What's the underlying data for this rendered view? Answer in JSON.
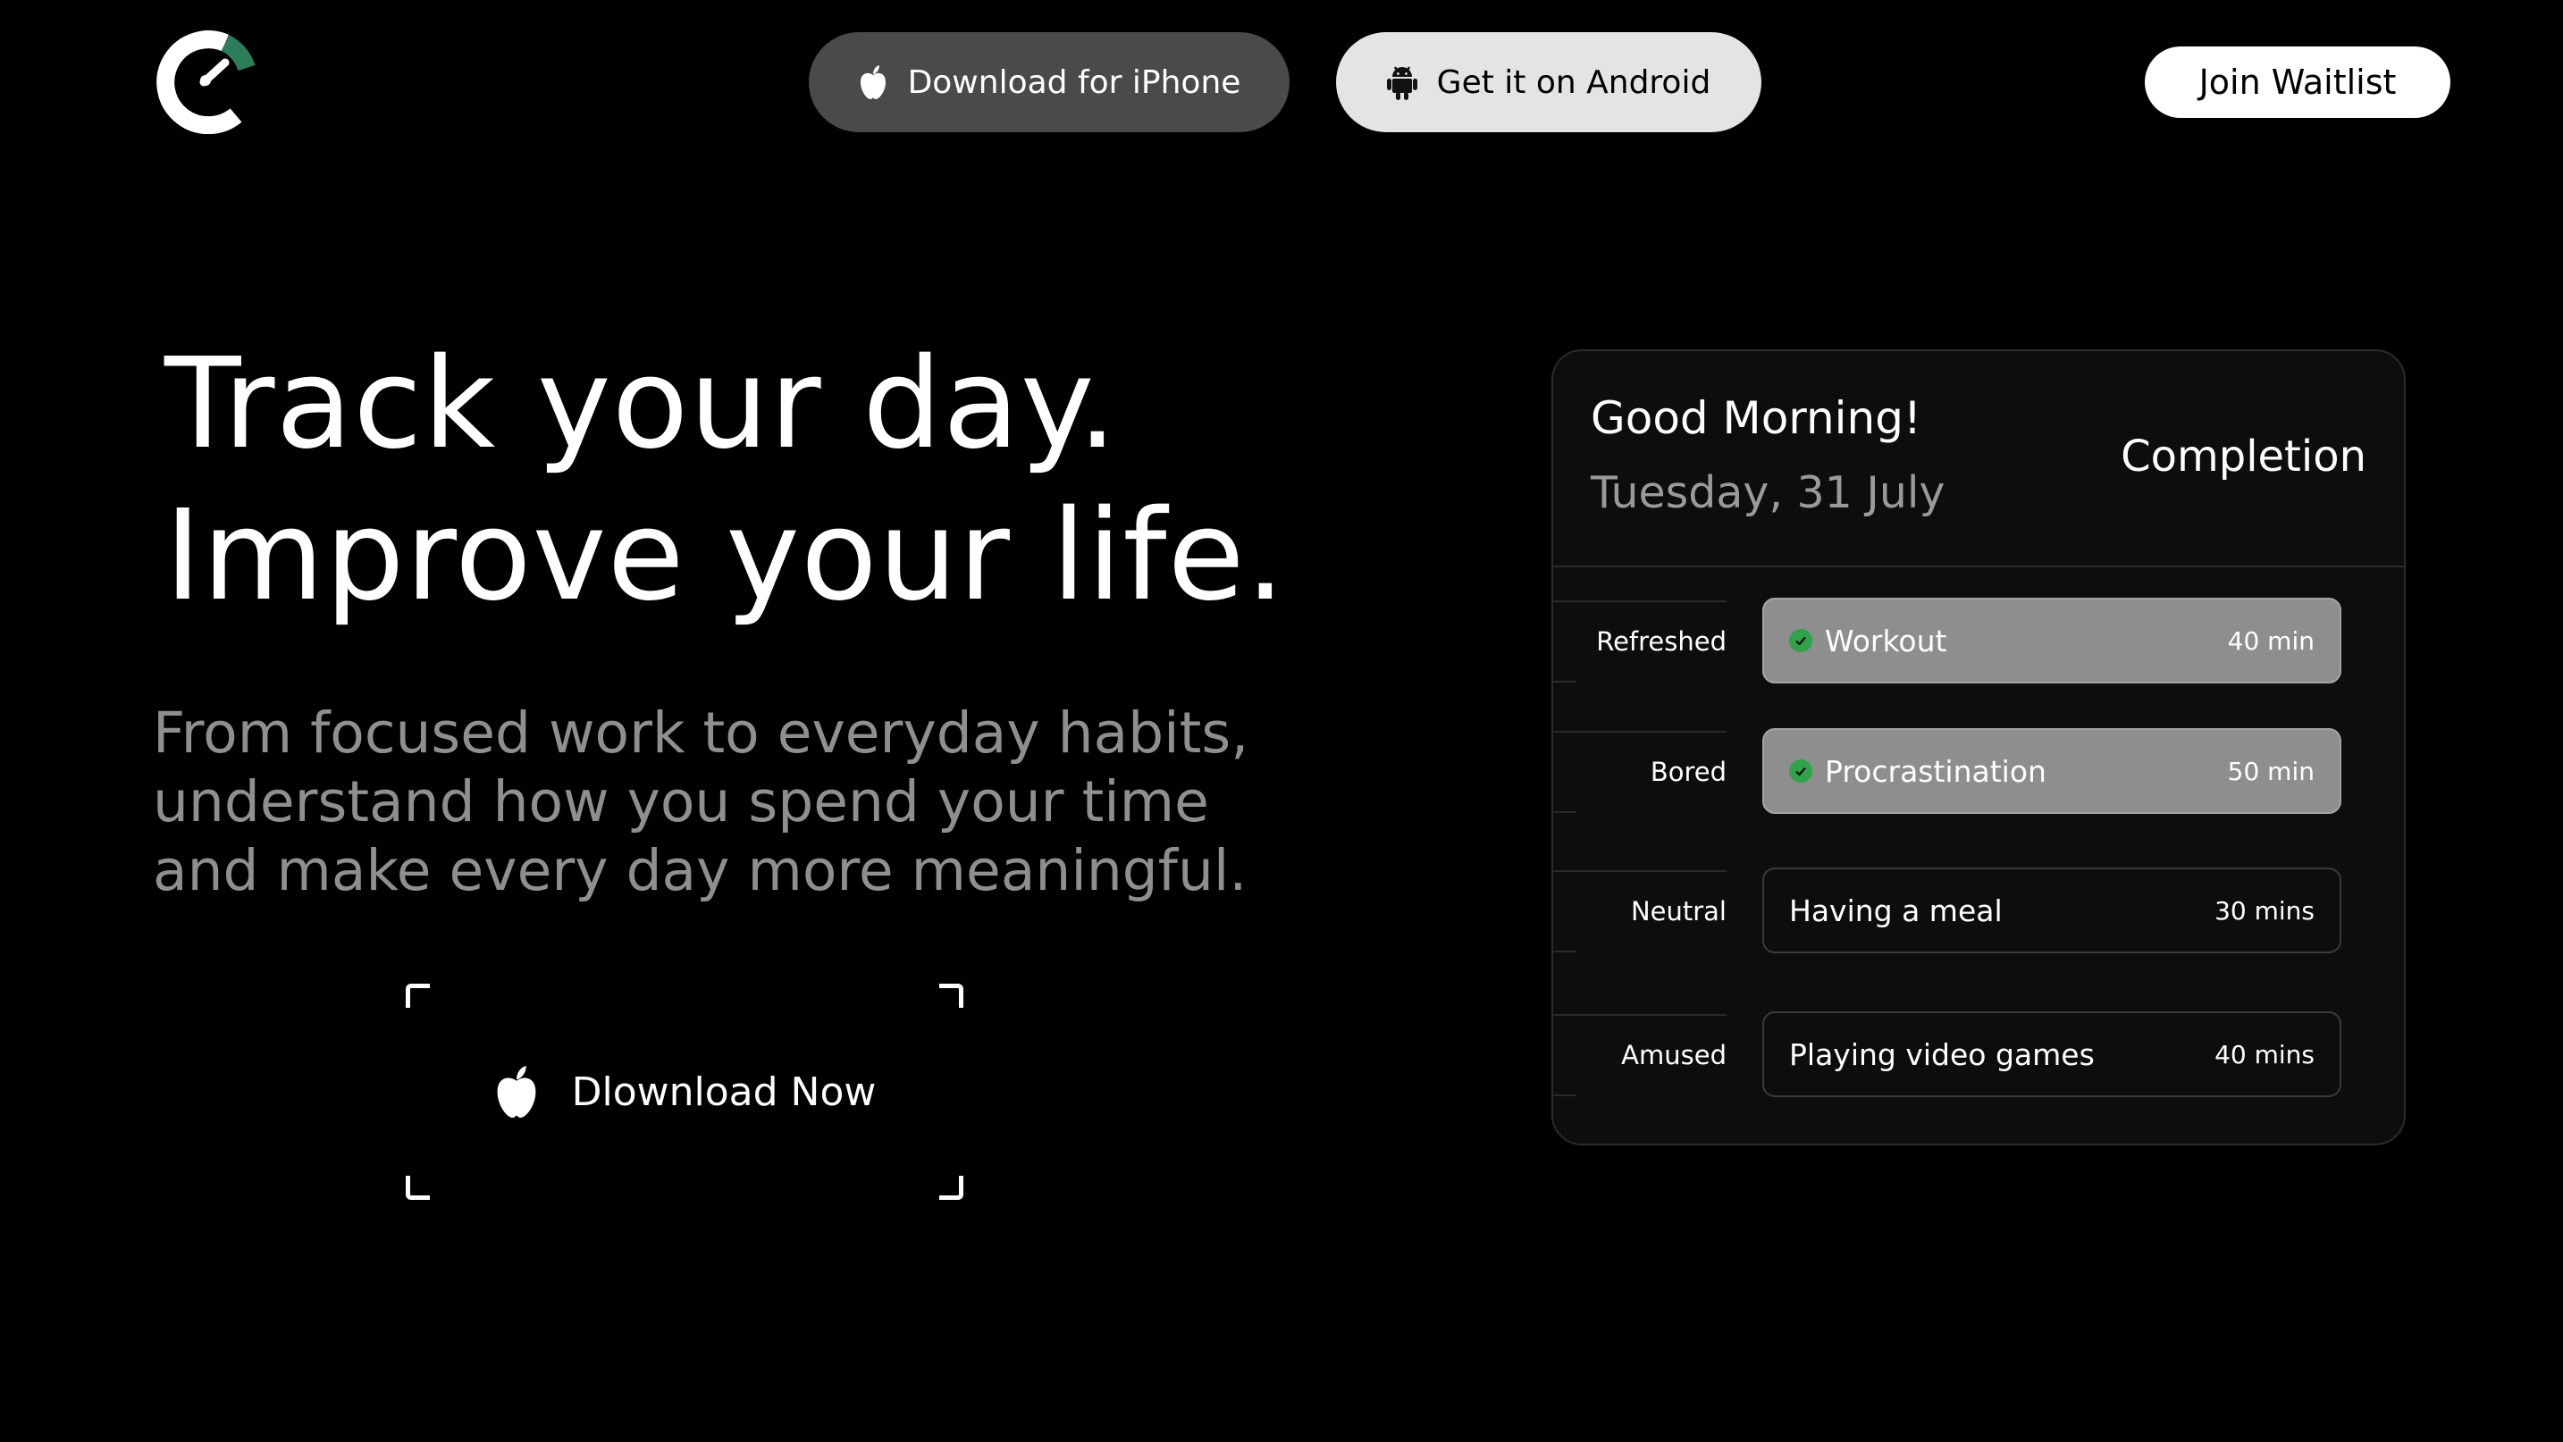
{
  "nav": {
    "logo_name": "brand-logo",
    "iphone_button": "Download for iPhone",
    "android_button": "Get it on Android",
    "waitlist_button": "Join Waitlist"
  },
  "hero": {
    "headline_line1": "Track your day.",
    "headline_line2": "Improve your life.",
    "subtitle_line1": "From focused work to everyday habits,",
    "subtitle_line2": "understand how you spend your time",
    "subtitle_line3": "and make every day more meaningful.",
    "cta_label": "Dlownload Now"
  },
  "card": {
    "greeting": "Good Morning!",
    "date": "Tuesday, 31 July",
    "completion_label": "Completion",
    "entries": [
      {
        "mood": "Refreshed",
        "activity": "Workout",
        "duration": "40 min",
        "done": true
      },
      {
        "mood": "Bored",
        "activity": "Procrastination",
        "duration": "50 min",
        "done": true
      },
      {
        "mood": "Neutral",
        "activity": "Having a meal",
        "duration": "30 mins",
        "done": false
      },
      {
        "mood": "Amused",
        "activity": "Playing video games",
        "duration": "40 mins",
        "done": false
      }
    ]
  },
  "colors": {
    "background": "#000000",
    "iphone_button_bg": "#4a4a4a",
    "android_button_bg": "#e4e4e4",
    "done_row_bg": "#8e8e8e",
    "check_green": "#2fa24a",
    "logo_accent": "#2e7d5a"
  },
  "icons": {
    "iphone": "apple-icon",
    "android": "android-icon",
    "check": "check-circle-icon"
  }
}
